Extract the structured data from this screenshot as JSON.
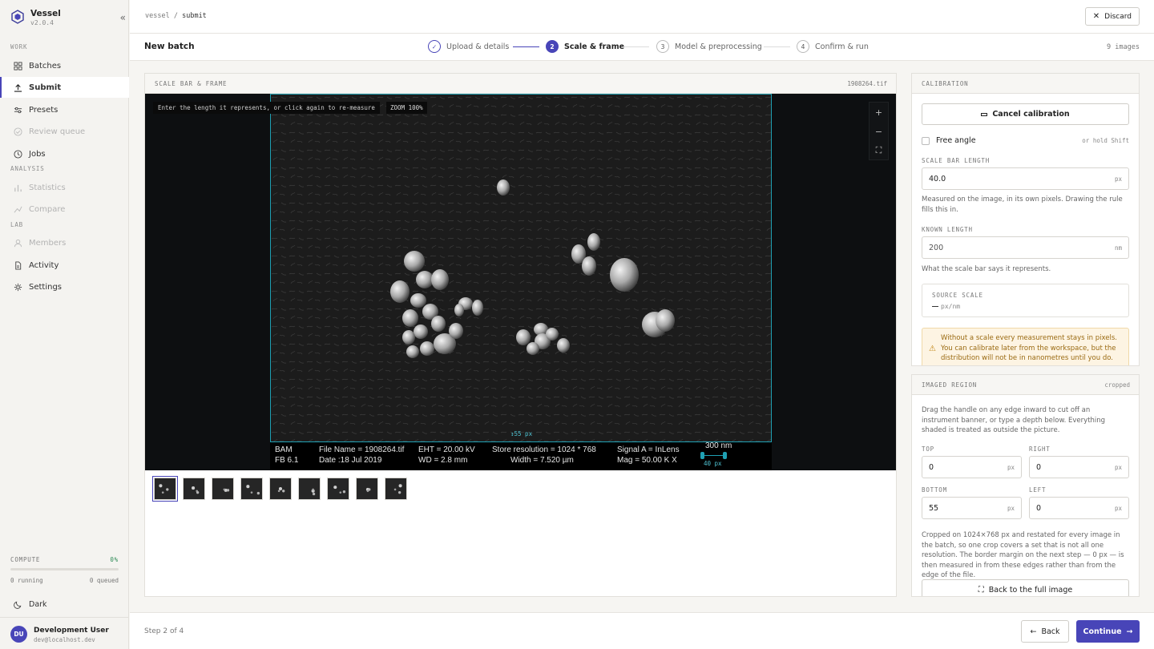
{
  "app": {
    "name": "Vessel",
    "version": "v2.0.4",
    "collapse_glyph": "«"
  },
  "nav": {
    "work_label": "WORK",
    "analysis_label": "ANALYSIS",
    "lab_label": "LAB",
    "items": [
      {
        "label": "Batches",
        "icon": "grid-icon"
      },
      {
        "label": "Submit",
        "icon": "upload-icon",
        "active": true
      },
      {
        "label": "Presets",
        "icon": "sliders-icon"
      },
      {
        "label": "Review queue",
        "icon": "check-circle-icon",
        "disabled": true
      },
      {
        "label": "Jobs",
        "icon": "clock-icon"
      },
      {
        "label": "Statistics",
        "icon": "bar-chart-icon",
        "disabled": true
      },
      {
        "label": "Compare",
        "icon": "compare-icon",
        "disabled": true
      },
      {
        "label": "Members",
        "icon": "user-icon",
        "disabled": true
      },
      {
        "label": "Activity",
        "icon": "document-icon"
      },
      {
        "label": "Settings",
        "icon": "gear-icon"
      }
    ]
  },
  "compute": {
    "label": "COMPUTE",
    "percent": "0%",
    "running": "0 running",
    "queued": "0 queued"
  },
  "theme": {
    "label": "Dark"
  },
  "user": {
    "initials": "DU",
    "name": "Development User",
    "email": "dev@localhost.dev"
  },
  "breadcrumb": {
    "parent": "vessel",
    "sep": "/",
    "current": "submit"
  },
  "discard": {
    "label": "Discard"
  },
  "batch": {
    "title": "New batch",
    "count": "9 images"
  },
  "steps": [
    {
      "num": "✓",
      "label": "Upload & details",
      "state": "done"
    },
    {
      "num": "2",
      "label": "Scale & frame",
      "state": "current"
    },
    {
      "num": "3",
      "label": "Model & preprocessing",
      "state": "todo"
    },
    {
      "num": "4",
      "label": "Confirm & run",
      "state": "todo"
    }
  ],
  "viewer": {
    "title": "SCALE BAR & FRAME",
    "file": "1908264.tif",
    "hint": "Enter the length it represents, or click again to re-measure",
    "zoom": "ZOOM 100%",
    "zoom_in": "+",
    "zoom_out": "−",
    "fit": "⛶",
    "crop_label": "↕55 px",
    "ruler_label": "40 px",
    "databar": {
      "inst1": "BAM",
      "inst2": "FB 6.1",
      "file_name": "File Name = 1908264.tif",
      "date": "Date :18 Jul 2019",
      "eht": "EHT = 20.00 kV",
      "wd": "WD =  2.8 mm",
      "store": "Store resolution = 1024 * 768",
      "width": "Width = 7.520 µm",
      "signal": "Signal A = InLens",
      "mag": "Mag =   50.00 K X",
      "scale": "300 nm"
    },
    "thumb_count": 9
  },
  "calibration": {
    "title": "CALIBRATION",
    "cancel_label": "Cancel calibration",
    "free_angle": "Free angle",
    "free_angle_hint": "or hold Shift",
    "scale_bar_label": "SCALE BAR LENGTH",
    "scale_bar_value": "40.0",
    "scale_bar_unit": "px",
    "scale_bar_help": "Measured on the image, in its own pixels. Drawing the rule fills this in.",
    "known_label": "KNOWN LENGTH",
    "known_value": "200",
    "known_unit": "nm",
    "known_help": "What the scale bar says it represents.",
    "source_label": "SOURCE SCALE",
    "source_value": "px/nm",
    "warning": "Without a scale every measurement stays in pixels. You can calibrate later from the workspace, but the distribution will not be in nanometres until you do."
  },
  "region": {
    "title": "IMAGED REGION",
    "tag": "cropped",
    "help": "Drag the handle on any edge inward to cut off an instrument banner, or type a depth below. Everything shaded is treated as outside the picture.",
    "top_label": "TOP",
    "top_value": "0",
    "right_label": "RIGHT",
    "right_value": "0",
    "bottom_label": "BOTTOM",
    "bottom_value": "55",
    "left_label": "LEFT",
    "left_value": "0",
    "unit": "px",
    "note": "Cropped on 1024×768 px and restated for every image in the batch, so one crop covers a set that is not all one resolution. The border margin on the next step — 0 px — is then measured in from these edges rather than from the edge of the file.",
    "reset_label": "Back to the full image"
  },
  "footer": {
    "step": "Step 2 of 4",
    "back": "Back",
    "continue": "Continue"
  },
  "colors": {
    "accent": "#4845b8",
    "crop": "#1fa0b3",
    "warning_bg": "#fdf4e3"
  }
}
